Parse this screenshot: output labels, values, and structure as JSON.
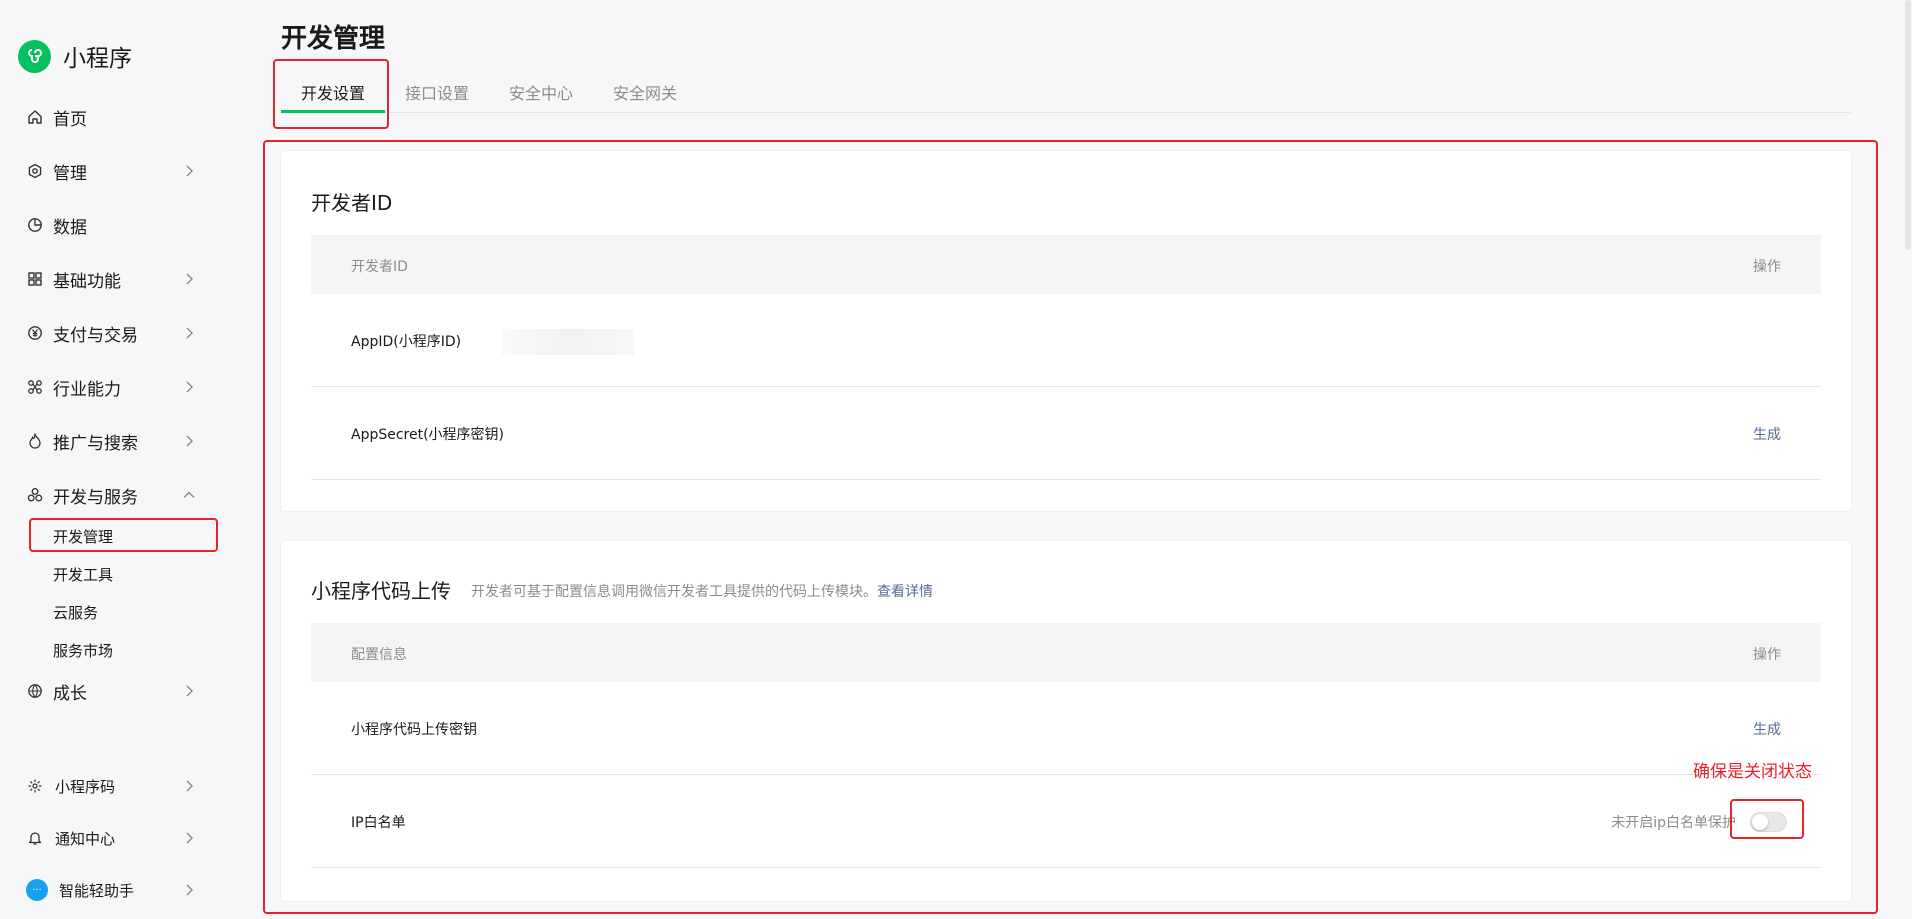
{
  "app": {
    "name": "小程序",
    "brand_color": "#07c160",
    "accent_color": "#576b95",
    "highlight_color": "#e6242b"
  },
  "sidebar": {
    "items": [
      {
        "label": "首页",
        "icon": "home-icon",
        "expandable": false
      },
      {
        "label": "管理",
        "icon": "hexagon-settings-icon",
        "expandable": true
      },
      {
        "label": "数据",
        "icon": "pie-chart-icon",
        "expandable": false
      },
      {
        "label": "基础功能",
        "icon": "grid-icon",
        "expandable": true
      },
      {
        "label": "支付与交易",
        "icon": "yen-circle-icon",
        "expandable": true
      },
      {
        "label": "行业能力",
        "icon": "nodes-icon",
        "expandable": true
      },
      {
        "label": "推广与搜索",
        "icon": "flame-icon",
        "expandable": true
      },
      {
        "label": "开发与服务",
        "icon": "cluster-icon",
        "expandable": true,
        "expanded": true
      },
      {
        "label": "成长",
        "icon": "globe-layers-icon",
        "expandable": true
      }
    ],
    "subitems": [
      {
        "label": "开发管理",
        "active": true
      },
      {
        "label": "开发工具"
      },
      {
        "label": "云服务"
      },
      {
        "label": "服务市场"
      }
    ],
    "bottom": [
      {
        "label": "小程序码",
        "icon": "code-icon"
      },
      {
        "label": "通知中心",
        "icon": "bell-icon"
      },
      {
        "label": "智能轻助手",
        "icon": "assistant-avatar",
        "avatar_text": "···"
      }
    ]
  },
  "main": {
    "title": "开发管理",
    "tabs": [
      {
        "label": "开发设置",
        "active": true
      },
      {
        "label": "接口设置"
      },
      {
        "label": "安全中心"
      },
      {
        "label": "安全网关"
      }
    ],
    "developer_id_card": {
      "title": "开发者ID",
      "header": {
        "col1": "开发者ID",
        "col2": "操作"
      },
      "rows": [
        {
          "label": "AppID(小程序ID)",
          "value_masked": true,
          "action": ""
        },
        {
          "label": "AppSecret(小程序密钥)",
          "action": "生成"
        }
      ]
    },
    "upload_card": {
      "title": "小程序代码上传",
      "subtitle": "开发者可基于配置信息调用微信开发者工具提供的代码上传模块。",
      "link": "查看详情",
      "header": {
        "col1": "配置信息",
        "col2": "操作"
      },
      "rows": [
        {
          "label": "小程序代码上传密钥",
          "action": "生成"
        },
        {
          "label": "IP白名单",
          "toggle_label": "未开启ip白名单保护",
          "toggle_on": false
        }
      ]
    },
    "annotation": "确保是关闭状态"
  }
}
